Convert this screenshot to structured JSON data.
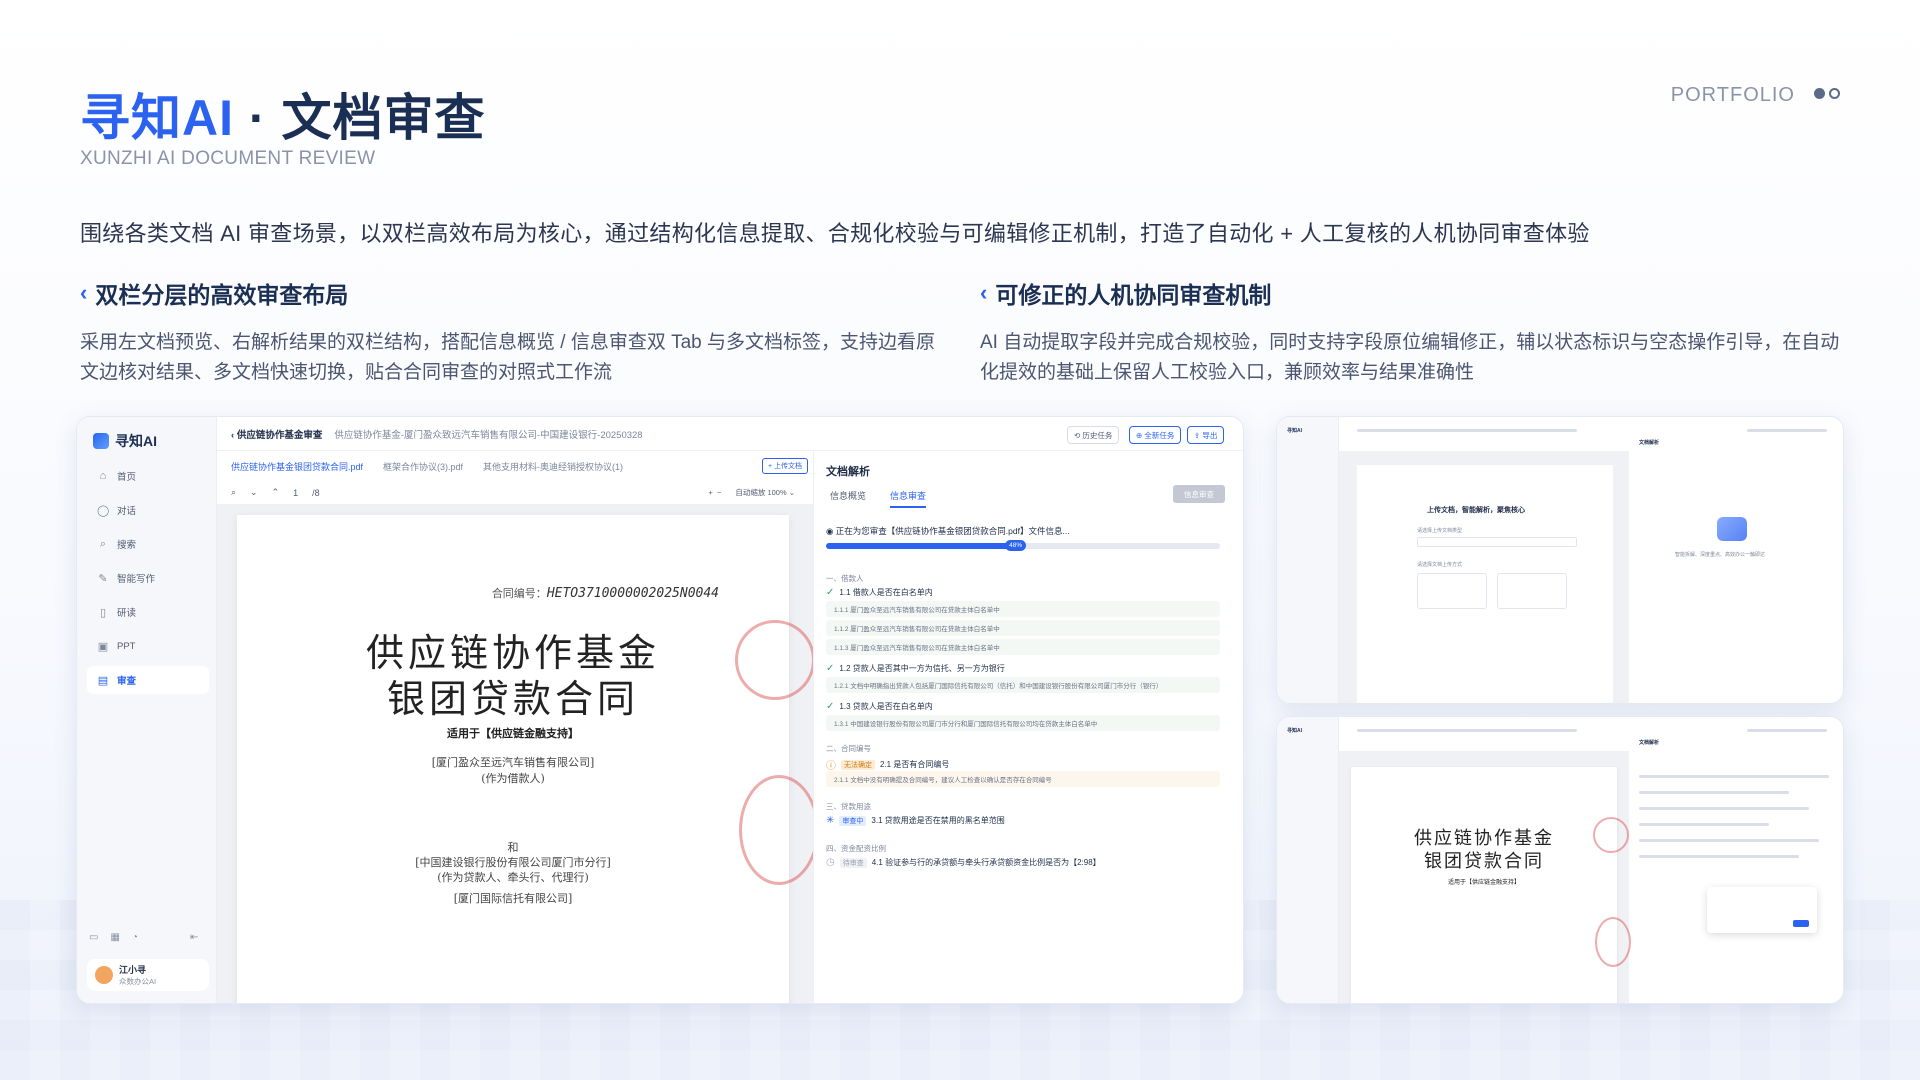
{
  "header": {
    "title_blue": "寻知AI",
    "title_sep": "·",
    "title_dark": "文档审查",
    "subtitle": "XUNZHI AI DOCUMENT REVIEW",
    "portfolio": "PORTFOLIO"
  },
  "intro": "围绕各类文档 AI 审查场景，以双栏高效布局为核心，通过结构化信息提取、合规化校验与可编辑修正机制，打造了自动化 + 人工复核的人机协同审查体验",
  "features": [
    {
      "title": "双栏分层的高效审查布局",
      "desc": "采用左文档预览、右解析结果的双栏结构，搭配信息概览 / 信息审查双 Tab 与多文档标签，支持边看原文边核对结果、多文档快速切换，贴合合同审查的对照式工作流"
    },
    {
      "title": "可修正的人机协同审查机制",
      "desc": "AI 自动提取字段并完成合规校验，同时支持字段原位编辑修正，辅以状态标识与空态操作引导，在自动化提效的基础上保留人工校验入口，兼顾效率与结果准确性"
    }
  ],
  "app": {
    "logo": "寻知AI",
    "nav": [
      {
        "icon": "home-icon",
        "glyph": "⌂",
        "label": "首页"
      },
      {
        "icon": "chat-icon",
        "glyph": "◯",
        "label": "对话"
      },
      {
        "icon": "search-icon",
        "glyph": "⌕",
        "label": "搜索"
      },
      {
        "icon": "pen-icon",
        "glyph": "✎",
        "label": "智能写作"
      },
      {
        "icon": "book-icon",
        "glyph": "▯",
        "label": "研读"
      },
      {
        "icon": "ppt-icon",
        "glyph": "▣",
        "label": "PPT"
      },
      {
        "icon": "review-icon",
        "glyph": "▤",
        "label": "审查"
      }
    ],
    "user": {
      "name": "江小寻",
      "org": "众数办公AI"
    },
    "back_label": "供应链协作基金审查",
    "breadcrumb": "供应链协作基金-厦门盈众致远汽车销售有限公司-中国建设银行-20250328",
    "buttons": {
      "history": "历史任务",
      "new_task": "全新任务",
      "export": "导出",
      "upload": "上传文档",
      "review": "信息审查"
    },
    "doc_tabs": [
      "供应链协作基金银团贷款合同.pdf",
      "框架合作协议(3).pdf",
      "其他支用材料-奥迪经销授权协议(1)"
    ],
    "toolbar": {
      "page": "1",
      "total": "/8",
      "zoom_label": "自动缩放",
      "zoom": "100%"
    },
    "document": {
      "contract_no_label": "合同编号：",
      "contract_no": "HETO3710000002025N0044",
      "title_l1": "供应链协作基金",
      "title_l2": "银团贷款合同",
      "applies": "适用于【供应链金融支持】",
      "party1": "[厦门盈众至远汽车销售有限公司]",
      "party1_role": "(作为借款人)",
      "and": "和",
      "party2": "[中国建设银行股份有限公司厦门市分行]",
      "party2_role": "(作为贷款人、牵头行、代理行)",
      "party3": "[厦门国际信托有限公司]"
    },
    "panel": {
      "title": "文档解析",
      "tabs": [
        "信息概览",
        "信息审查"
      ],
      "progress_text": "正在为您审查【供应链协作基金银团贷款合同.pdf】文件信息...",
      "progress_value": 0.48,
      "progress_label": "48%",
      "sections": [
        {
          "label": "一、借款人"
        },
        {
          "label": "二、合同编号"
        },
        {
          "label": "三、贷款用途"
        },
        {
          "label": "四、资金配资比例"
        }
      ],
      "items": [
        {
          "status": "ok",
          "text": "1.1 借款人是否在白名单内"
        },
        {
          "status": "ok",
          "text": "1.2 贷款人是否其中一方为信托、另一方为银行"
        },
        {
          "status": "ok",
          "text": "1.3 贷款人是否在白名单内"
        },
        {
          "status": "warn",
          "tag": "无法确定",
          "text": "2.1 是否有合同编号"
        },
        {
          "status": "loading",
          "tag": "审查中",
          "text": "3.1 贷款用途是否在禁用的黑名单范围"
        },
        {
          "status": "wait",
          "tag": "待审查",
          "text": "4.1 验证参与行的承贷额与牵头行承贷额资金比例是否为【2:98】"
        }
      ],
      "rows": [
        "1.1.1 厦门盈众至远汽车销售有限公司在贷款主体白名单中",
        "1.1.2 厦门盈众至远汽车销售有限公司在贷款主体白名单中",
        "1.1.3 厦门盈众至远汽车销售有限公司在贷款主体白名单中",
        "1.2.1 文档中明确指出贷款人包括厦门国际信托有限公司（信托）和中国建设银行股份有限公司厦门市分行（银行）",
        "1.3.1 中国建设银行股份有限公司厦门市分行和厦门国际信托有限公司均在贷款主体白名单中",
        "2.1.1 文档中没有明确提及合同编号，建议人工检查以确认是否存在合同编号"
      ]
    }
  },
  "mini_top": {
    "upload_title": "上传文档，智能解析，聚焦核心",
    "step1": "请选择上传文档类型",
    "step2": "请选择文档上传方式",
    "empty_hint": "智能拆解、深度重点、高效办公一触即达",
    "panel_title": "文档解析"
  },
  "mini_bottom": {
    "title_l1": "供应链协作基金",
    "title_l2": "银团贷款合同",
    "applies": "适用于【供应链金融支持】",
    "panel_title": "文档解析"
  }
}
